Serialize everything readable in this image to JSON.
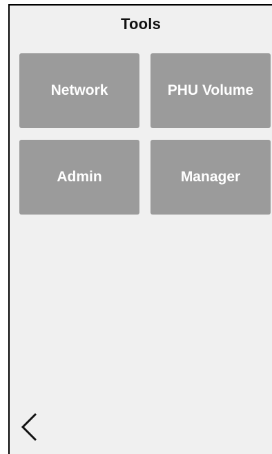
{
  "header": {
    "title": "Tools"
  },
  "tiles": [
    {
      "label": "Network"
    },
    {
      "label": "PHU Volume"
    },
    {
      "label": "Admin"
    },
    {
      "label": "Manager"
    }
  ],
  "footer": {
    "back_icon": "chevron-left-icon"
  },
  "colors": {
    "background": "#f0f0f0",
    "tile": "#9b9b9b",
    "tile_text": "#ffffff",
    "title_text": "#111111"
  }
}
